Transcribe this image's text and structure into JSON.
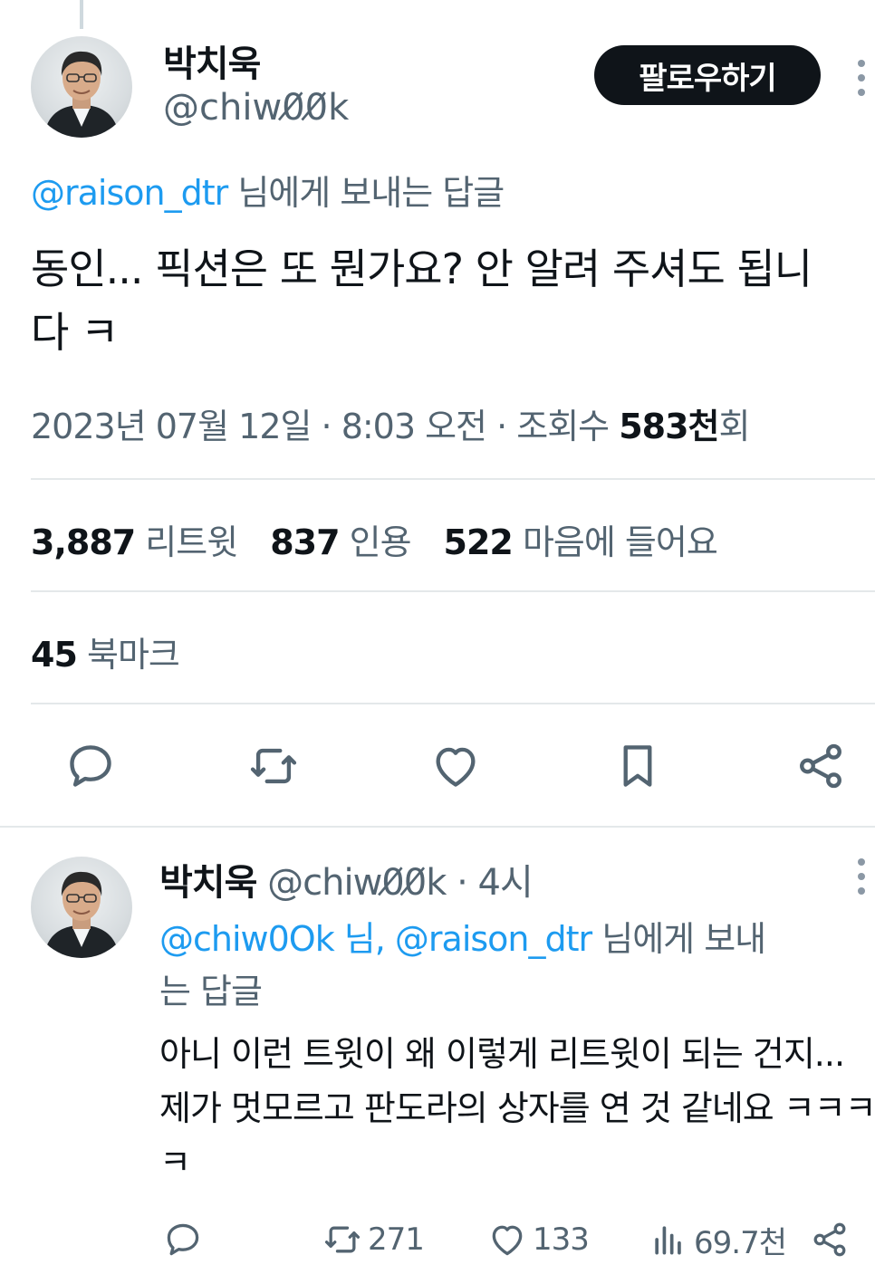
{
  "main_tweet": {
    "author": {
      "name": "박치욱",
      "handle": "@chiw0̸0̸k"
    },
    "follow_label": "팔로우하기",
    "reply_to": {
      "mention": "@raison_dtr",
      "suffix": " 님에게 보내는 답글"
    },
    "text": "동인... 픽션은 또 뭔가요? 안 알려 주셔도 됩니다 ㅋ",
    "meta": {
      "datetime": "2023년 07월 12일 · 8:03 오전 · 조회수 ",
      "views": "583천",
      "views_suffix": "회"
    },
    "stats": {
      "retweets": {
        "count": "3,887",
        "label": "리트윗"
      },
      "quotes": {
        "count": "837",
        "label": "인용"
      },
      "likes": {
        "count": "522",
        "label": "마음에 들어요"
      },
      "bookmarks": {
        "count": "45",
        "label": "북마크"
      }
    },
    "actions": [
      "reply-icon",
      "retweet-icon",
      "like-icon",
      "bookmark-icon",
      "share-icon"
    ]
  },
  "reply_tweet": {
    "author": {
      "name": "박치욱",
      "handle_time": " @chiw0̸0̸k · 4시"
    },
    "reply_to": {
      "mention1": "@chiw0Ok 님, ",
      "mention2": "@raison_dtr",
      "suffix": " 님에게 보내는 답글"
    },
    "text": "아니 이런 트윗이 왜 이렇게 리트윗이 되는 건지... 제가 멋모르고 판도라의 상자를 연 것 같네요 ㅋㅋㅋㅋ",
    "actions": {
      "retweets": "271",
      "likes": "133",
      "views": "69.7천"
    }
  },
  "colors": {
    "accent": "#1d9bf0",
    "text": "#0f1419",
    "secondary": "#536471",
    "divider": "#e4e8ea"
  }
}
